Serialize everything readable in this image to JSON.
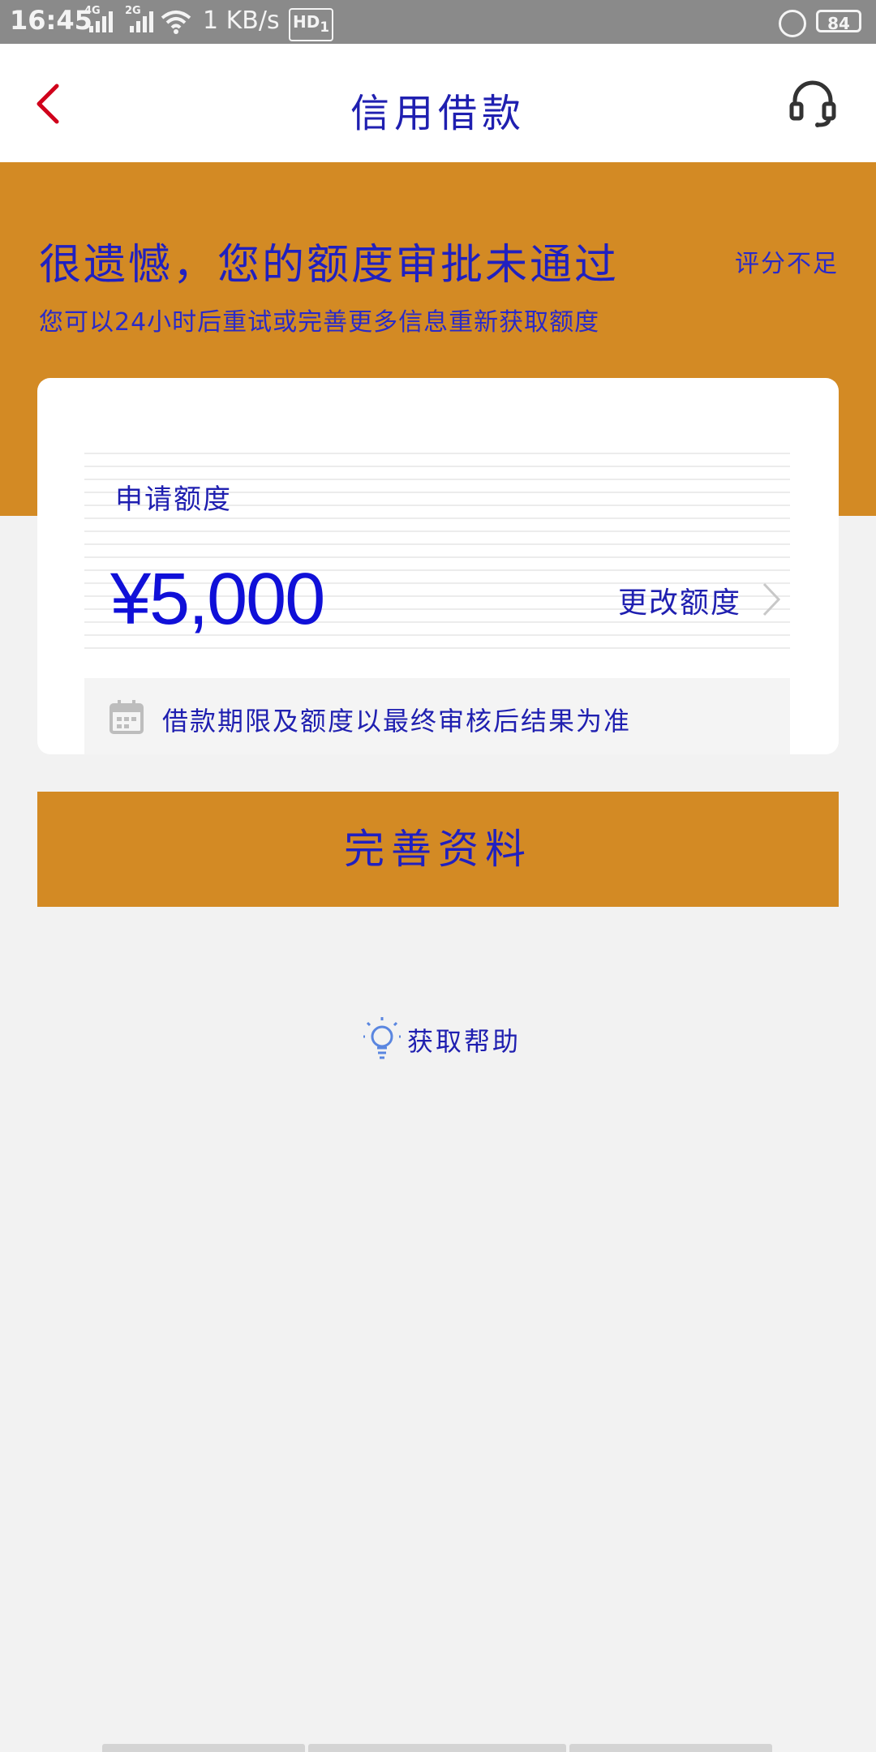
{
  "status_bar": {
    "time": "16:45",
    "network_1": "4G",
    "network_2": "2G",
    "speed": "1 KB/s",
    "hd": "HD",
    "hd_slot": "1",
    "battery": "84"
  },
  "header": {
    "title": "信用借款",
    "back_icon": "chevron-left-icon",
    "support_icon": "headset-icon"
  },
  "banner": {
    "headline": "很遗憾，您的额度审批未通过",
    "score_note": "评分不足",
    "subtitle": "您可以24小时后重试或完善更多信息重新获取额度"
  },
  "card": {
    "amount_label": "申请额度",
    "amount": "¥5,000",
    "change_link": "更改额度",
    "note": "借款期限及额度以最终审核后结果为准",
    "note_icon": "calendar-icon"
  },
  "cta": {
    "label": "完善资料"
  },
  "help": {
    "label": "获取帮助",
    "icon": "lightbulb-icon"
  },
  "colors": {
    "accent": "#d38a24",
    "text_blue": "#1f1fb0",
    "back_red": "#d0021b",
    "background": "#f2f2f2"
  }
}
